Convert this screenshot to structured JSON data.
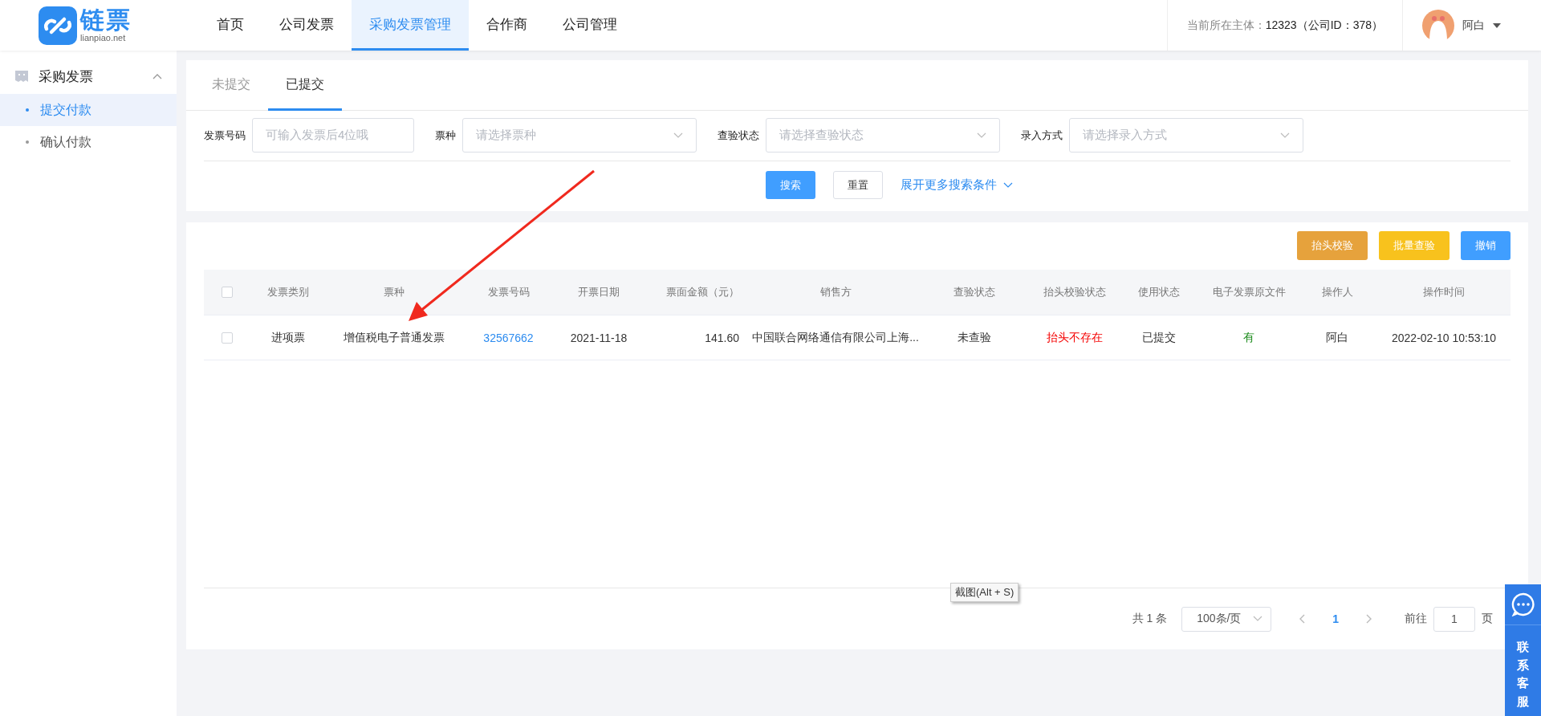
{
  "header": {
    "logo": {
      "name": "链票",
      "domain": "lianpiao.net"
    },
    "nav": [
      {
        "label": "首页",
        "selected": false
      },
      {
        "label": "公司发票",
        "selected": false
      },
      {
        "label": "采购发票管理",
        "selected": true
      },
      {
        "label": "合作商",
        "selected": false
      },
      {
        "label": "公司管理",
        "selected": false
      }
    ],
    "entity_label": "当前所在主体：",
    "entity_value": "12323（公司ID：378）",
    "user": "阿白"
  },
  "sidebar": {
    "group": {
      "label": "采购发票",
      "expanded": true
    },
    "items": [
      {
        "label": "提交付款",
        "selected": true
      },
      {
        "label": "确认付款",
        "selected": false
      }
    ]
  },
  "tabs": [
    {
      "label": "未提交",
      "selected": false
    },
    {
      "label": "已提交",
      "selected": true
    }
  ],
  "filters": [
    {
      "label": "发票号码",
      "kind": "input",
      "placeholder": "可输入发票后4位哦"
    },
    {
      "label": "票种",
      "kind": "select",
      "placeholder": "请选择票种"
    },
    {
      "label": "查验状态",
      "kind": "select",
      "placeholder": "请选择查验状态"
    },
    {
      "label": "录入方式",
      "kind": "select",
      "placeholder": "请选择录入方式"
    }
  ],
  "search_buttons": {
    "search": "搜索",
    "reset": "重置",
    "more": "展开更多搜索条件"
  },
  "toolbar": [
    {
      "label": "抬头校验",
      "color": "#e6a23c"
    },
    {
      "label": "批量查验",
      "color": "#f8c21d"
    },
    {
      "label": "撤销",
      "color": "#409eff"
    }
  ],
  "table": {
    "columns": [
      "发票类别",
      "票种",
      "发票号码",
      "开票日期",
      "票面金额（元）",
      "销售方",
      "查验状态",
      "抬头校验状态",
      "使用状态",
      "电子发票原文件",
      "操作人",
      "操作时间"
    ],
    "header_checked": false,
    "rows": [
      {
        "checked": false,
        "cells": [
          {
            "kind": "text",
            "text": "进项票"
          },
          {
            "kind": "text",
            "text": "增值税电子普通发票"
          },
          {
            "kind": "link",
            "text": "32567662"
          },
          {
            "kind": "text",
            "text": "2021-11-18"
          },
          {
            "kind": "number",
            "text": "141.60"
          },
          {
            "kind": "text",
            "text": "中国联合网络通信有限公司上海..."
          },
          {
            "kind": "text",
            "text": "未查验"
          },
          {
            "kind": "status",
            "text": "抬头不存在",
            "color": "#f50000"
          },
          {
            "kind": "text",
            "text": "已提交"
          },
          {
            "kind": "status",
            "text": "有",
            "color": "#1a8a1a"
          },
          {
            "kind": "text",
            "text": "阿白"
          },
          {
            "kind": "text",
            "text": "2022-02-10 10:53:10"
          }
        ]
      }
    ]
  },
  "pagination": {
    "total": "共 1 条",
    "page_size": "100条/页",
    "pages": [
      {
        "label": "1",
        "selected": true
      }
    ],
    "goto_label": "前往",
    "goto_value": "1",
    "goto_suffix": "页"
  },
  "tooltip": "截图(Alt + S)",
  "service": {
    "label": "联系客服"
  }
}
